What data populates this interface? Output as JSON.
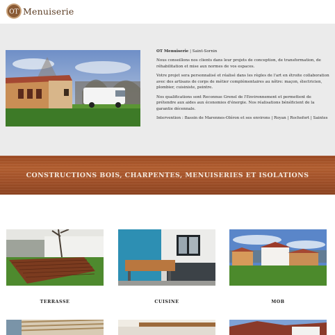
{
  "header": {
    "logo_initials": "OT",
    "logo_text": "Menuiserie"
  },
  "intro": {
    "brand": "OT Menuiserie",
    "brand_suffix": " | Saint-Sornin",
    "p1": "Nous conseillons nos clients dans leur projets de conception, de transformation, de réhabilitation et mise aux normes de vos espaces.",
    "p2": "Votre projet sera personnalisé et réalisé dans les règles de l'art en étroite collaboration avec des artisans de corps de métier complémentaires au nôtre: maçon, électricien, plombier, cuisiniste, peintre.",
    "p3": "Nos qualifications sont Reconnue Grenel de l'Environnement et permettent de prétendre aux aides aux économies d'énergie. Nos réalisations bénéficient de la garantie décennale.",
    "p4": "Intervention : Bassin de Marennes-Oléron et ses environs | Royan | Rochefort | Saintes"
  },
  "banner": {
    "title": "CONSTRUCTIONS BOIS, CHARPENTES, MENUISERIES ET ISOLATIONS"
  },
  "gallery": [
    {
      "label": "TERRASSE"
    },
    {
      "label": "CUISINE"
    },
    {
      "label": "MOB"
    }
  ],
  "colors": {
    "logo_brown": "#5a3b22",
    "intro_bg": "#ebebeb",
    "banner_wood": "#a5532a",
    "banner_text": "#f3e7dc"
  }
}
